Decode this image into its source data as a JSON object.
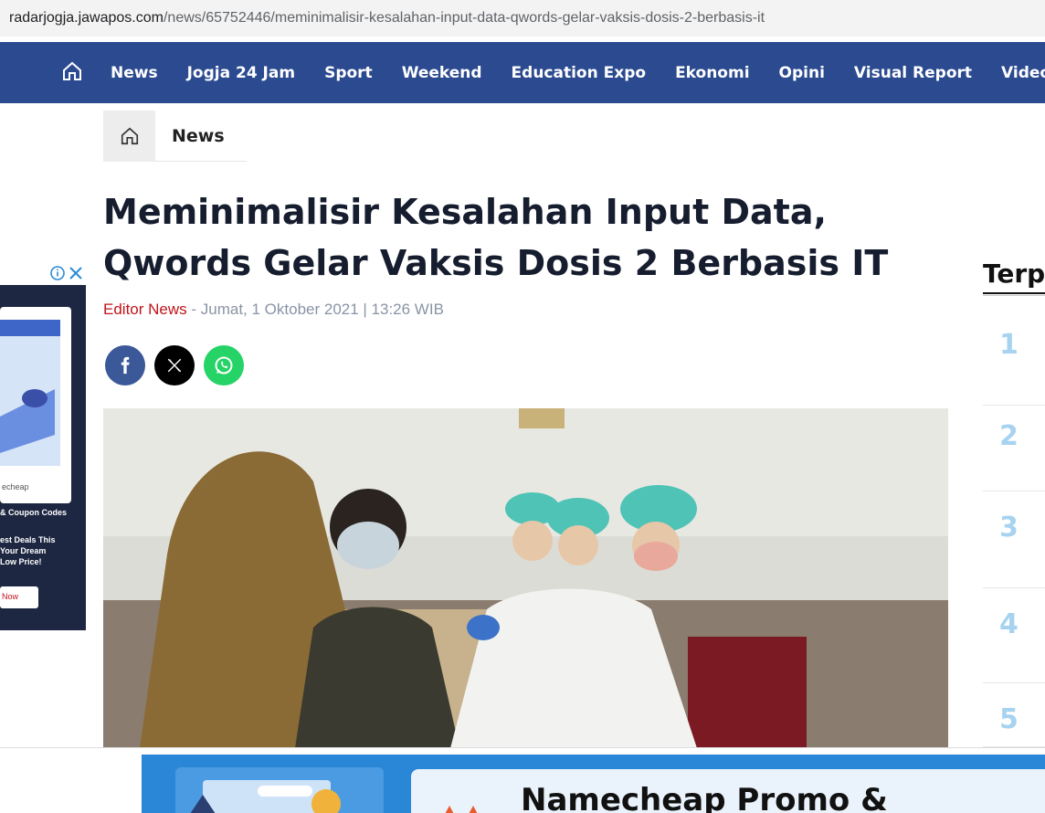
{
  "browser": {
    "url_domain": "radarjogja.jawapos.com",
    "url_path": "/news/65752446/meminimalisir-kesalahan-input-data-qwords-gelar-vaksis-dosis-2-berbasis-it"
  },
  "nav": {
    "items": [
      "News",
      "Jogja 24 Jam",
      "Sport",
      "Weekend",
      "Education Expo",
      "Ekonomi",
      "Opini",
      "Visual Report",
      "Video"
    ]
  },
  "breadcrumb": {
    "label": "News"
  },
  "article": {
    "title": "Meminimalisir Kesalahan Input Data, Qwords Gelar Vaksis Dosis 2 Berbasis IT",
    "author": "Editor News",
    "separator": " - ",
    "date": "Jumat, 1 Oktober 2021 | 13:26 WIB"
  },
  "share": [
    "facebook-icon",
    "x-icon",
    "whatsapp-icon"
  ],
  "left_ad": {
    "line1": "& Coupon Codes",
    "line2": "est Deals This",
    "line3": "Your Dream",
    "line4": "Low Price!",
    "button": "Now",
    "brand": "echeap"
  },
  "sidebar": {
    "title": "Terp",
    "ranks": [
      "1",
      "2",
      "3",
      "4",
      "5"
    ]
  },
  "bottom_ad": {
    "headline": "Namecheap Promo &"
  },
  "colors": {
    "nav_bg": "#2b4a8f",
    "author": "#c0141a",
    "rank": "#a7d3f0"
  }
}
